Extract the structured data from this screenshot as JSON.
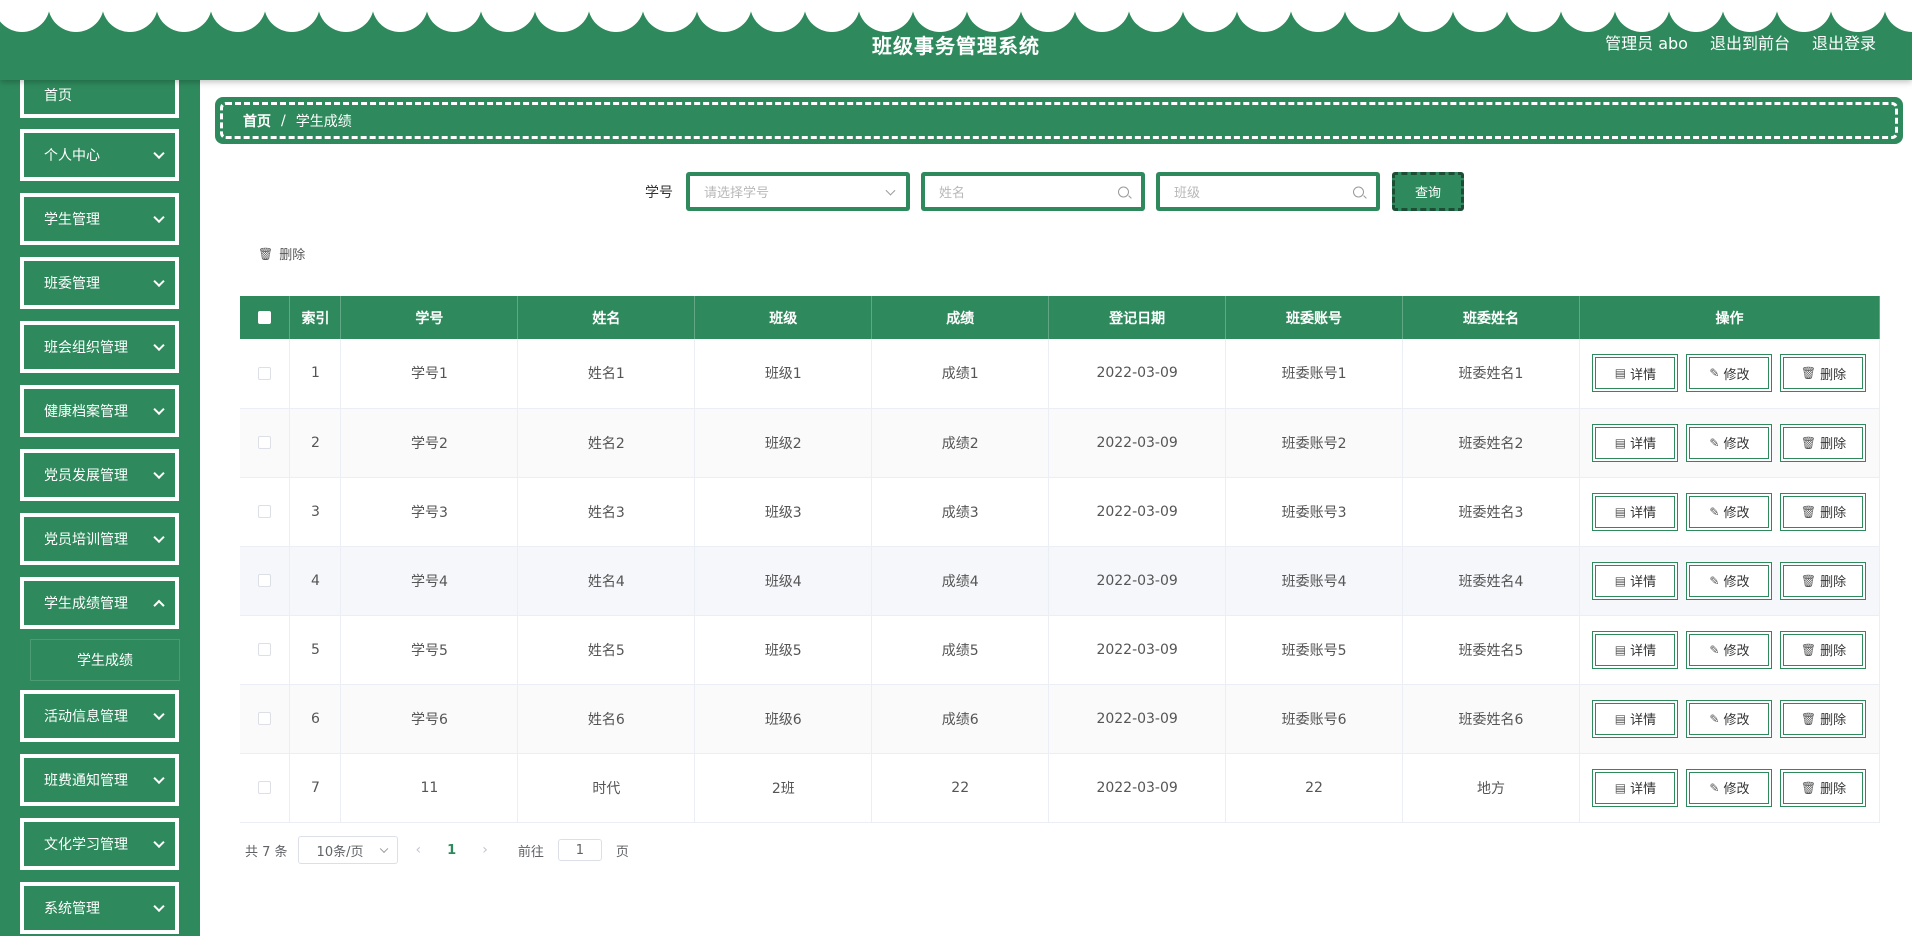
{
  "header": {
    "title": "班级事务管理系统",
    "user_label": "管理员 abo",
    "front_link": "退出到前台",
    "logout_link": "退出登录"
  },
  "sidebar": {
    "home": "首页",
    "items": [
      {
        "label": "个人中心"
      },
      {
        "label": "学生管理"
      },
      {
        "label": "班委管理"
      },
      {
        "label": "班会组织管理"
      },
      {
        "label": "健康档案管理"
      },
      {
        "label": "党员发展管理"
      },
      {
        "label": "党员培训管理"
      },
      {
        "label": "学生成绩管理"
      },
      {
        "label": "活动信息管理"
      },
      {
        "label": "班费通知管理"
      },
      {
        "label": "文化学习管理"
      },
      {
        "label": "系统管理"
      }
    ],
    "active_sub": "学生成绩"
  },
  "breadcrumb": {
    "home": "首页",
    "separator": "/",
    "current": "学生成绩"
  },
  "search": {
    "label": "学号",
    "student_no_placeholder": "请选择学号",
    "name_placeholder": "姓名",
    "class_placeholder": "班级",
    "query_label": "查询"
  },
  "toolbar": {
    "delete_label": "删除"
  },
  "table": {
    "columns": [
      "索引",
      "学号",
      "姓名",
      "班级",
      "成绩",
      "登记日期",
      "班委账号",
      "班委姓名",
      "操作"
    ],
    "actions": {
      "detail": "详情",
      "edit": "修改",
      "delete": "删除"
    },
    "rows": [
      {
        "index": "1",
        "student_no": "学号1",
        "name": "姓名1",
        "class": "班级1",
        "score": "成绩1",
        "date": "2022-03-09",
        "monitor_account": "班委账号1",
        "monitor_name": "班委姓名1"
      },
      {
        "index": "2",
        "student_no": "学号2",
        "name": "姓名2",
        "class": "班级2",
        "score": "成绩2",
        "date": "2022-03-09",
        "monitor_account": "班委账号2",
        "monitor_name": "班委姓名2"
      },
      {
        "index": "3",
        "student_no": "学号3",
        "name": "姓名3",
        "class": "班级3",
        "score": "成绩3",
        "date": "2022-03-09",
        "monitor_account": "班委账号3",
        "monitor_name": "班委姓名3"
      },
      {
        "index": "4",
        "student_no": "学号4",
        "name": "姓名4",
        "class": "班级4",
        "score": "成绩4",
        "date": "2022-03-09",
        "monitor_account": "班委账号4",
        "monitor_name": "班委姓名4"
      },
      {
        "index": "5",
        "student_no": "学号5",
        "name": "姓名5",
        "class": "班级5",
        "score": "成绩5",
        "date": "2022-03-09",
        "monitor_account": "班委账号5",
        "monitor_name": "班委姓名5"
      },
      {
        "index": "6",
        "student_no": "学号6",
        "name": "姓名6",
        "class": "班级6",
        "score": "成绩6",
        "date": "2022-03-09",
        "monitor_account": "班委账号6",
        "monitor_name": "班委姓名6"
      },
      {
        "index": "7",
        "student_no": "11",
        "name": "时代",
        "class": "2班",
        "score": "22",
        "date": "2022-03-09",
        "monitor_account": "22",
        "monitor_name": "地方"
      }
    ]
  },
  "pagination": {
    "total": "共 7 条",
    "page_size": "10条/页",
    "current_page": "1",
    "goto_label": "前往",
    "goto_value": "1",
    "page_suffix": "页"
  },
  "colors": {
    "primary": "#2e8a5c",
    "background": "#ffffff"
  }
}
